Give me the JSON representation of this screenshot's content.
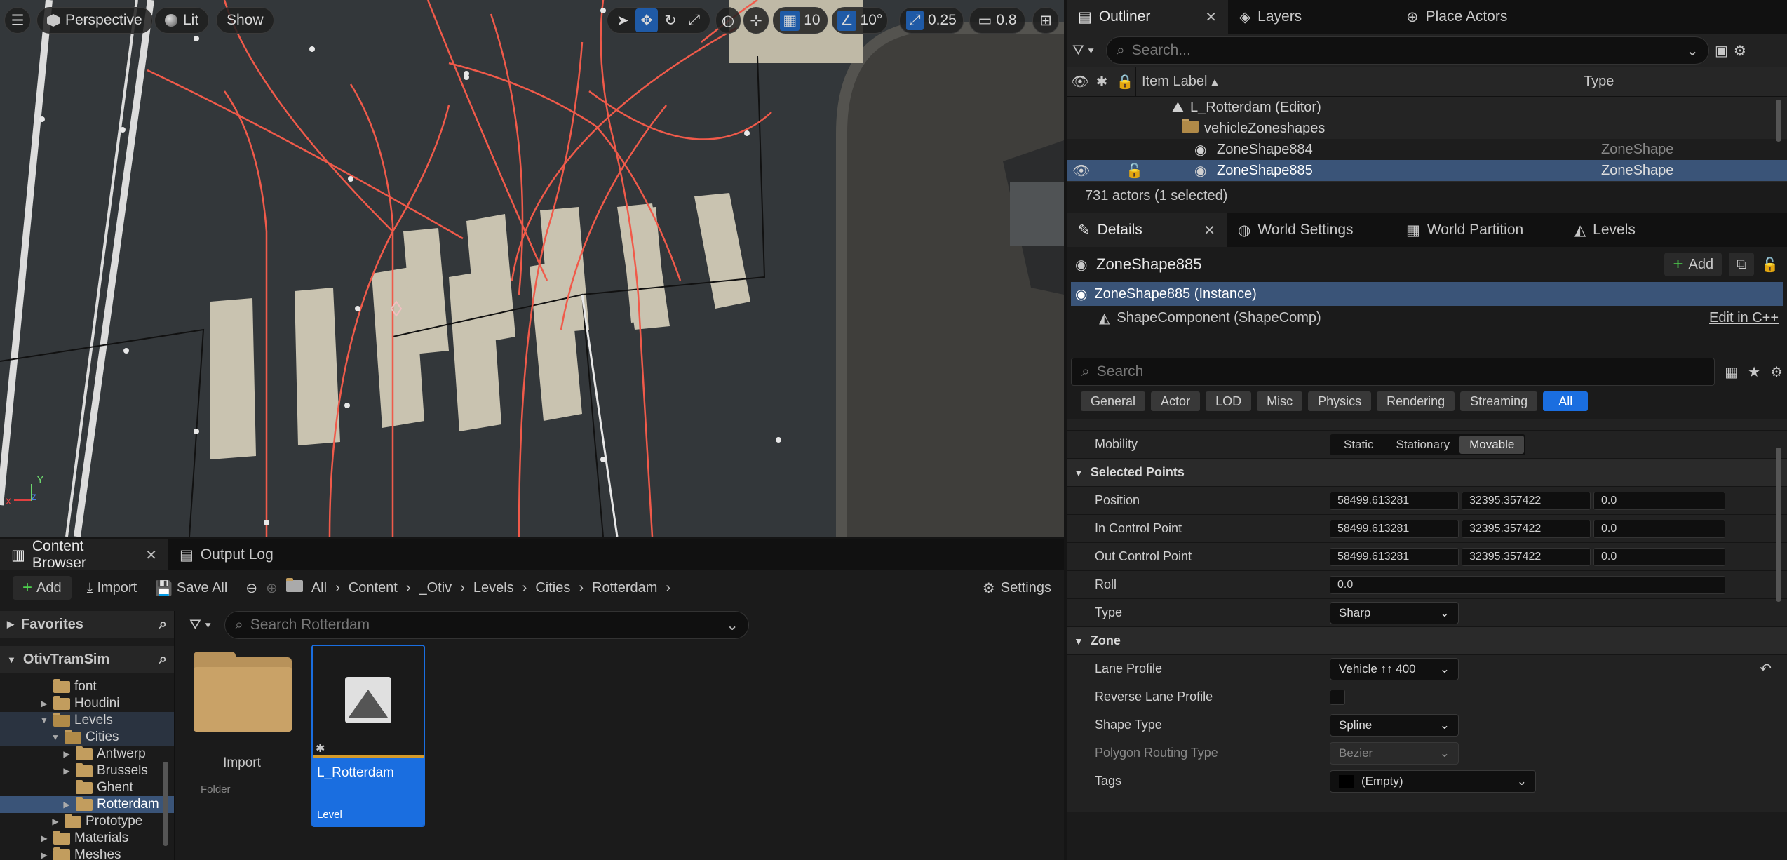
{
  "viewport": {
    "perspective_label": "Perspective",
    "lit_label": "Lit",
    "show_label": "Show",
    "grid_snap_value": "10",
    "rotation_snap_value": "10°",
    "scale_snap_value": "0.25",
    "camera_speed_value": "0.8",
    "axis_x": "x",
    "axis_y": "Y",
    "axis_z": "z"
  },
  "outliner": {
    "tabs": [
      {
        "label": "Outliner",
        "icon": "outliner-icon",
        "active": true
      },
      {
        "label": "Layers",
        "icon": "layers-icon"
      },
      {
        "label": "Place Actors",
        "icon": "place-actors-icon"
      }
    ],
    "search_placeholder": "Search...",
    "columns": {
      "item_label": "Item Label",
      "type": "Type"
    },
    "rows": [
      {
        "label": "L_Rotterdam (Editor)",
        "type": "",
        "kind": "level"
      },
      {
        "label": "vehicleZoneshapes",
        "type": "",
        "kind": "folder"
      },
      {
        "label": "ZoneShape884",
        "type": "ZoneShape",
        "kind": "actor"
      },
      {
        "label": "ZoneShape885",
        "type": "ZoneShape",
        "kind": "actor",
        "selected": true
      }
    ],
    "status": "731 actors (1 selected)"
  },
  "details": {
    "tabs": [
      {
        "label": "Details",
        "icon": "details-icon",
        "active": true
      },
      {
        "label": "World Settings",
        "icon": "world-settings-icon"
      },
      {
        "label": "World Partition",
        "icon": "world-partition-icon"
      },
      {
        "label": "Levels",
        "icon": "levels-icon"
      }
    ],
    "actor_name": "ZoneShape885",
    "add_label": "Add",
    "components": [
      {
        "label": "ZoneShape885 (Instance)",
        "selected": true
      },
      {
        "label": "ShapeComponent (ShapeComp)",
        "link": "Edit in C++"
      }
    ],
    "search_placeholder": "Search",
    "filters": [
      "General",
      "Actor",
      "LOD",
      "Misc",
      "Physics",
      "Rendering",
      "Streaming",
      "All"
    ],
    "active_filter": "All",
    "mobility": {
      "label": "Mobility",
      "options": [
        "Static",
        "Stationary",
        "Movable"
      ],
      "selected": "Movable"
    },
    "selected_points": {
      "header": "Selected Points",
      "position": {
        "label": "Position",
        "x": "58499.613281",
        "y": "32395.357422",
        "z": "0.0"
      },
      "in_control": {
        "label": "In Control Point",
        "x": "58499.613281",
        "y": "32395.357422",
        "z": "0.0"
      },
      "out_control": {
        "label": "Out Control Point",
        "x": "58499.613281",
        "y": "32395.357422",
        "z": "0.0"
      },
      "roll": {
        "label": "Roll",
        "value": "0.0"
      },
      "type": {
        "label": "Type",
        "value": "Sharp"
      }
    },
    "zone": {
      "header": "Zone",
      "lane_profile": {
        "label": "Lane Profile",
        "value": "Vehicle ↑↑ 400"
      },
      "reverse_lane_profile": {
        "label": "Reverse Lane Profile"
      },
      "shape_type": {
        "label": "Shape Type",
        "value": "Spline"
      },
      "polygon_routing_type": {
        "label": "Polygon Routing Type",
        "value": "Bezier"
      },
      "tags": {
        "label": "Tags",
        "value": "(Empty)"
      }
    }
  },
  "content_browser": {
    "tabs": [
      {
        "label": "Content Browser",
        "icon": "content-browser-icon",
        "active": true
      },
      {
        "label": "Output Log",
        "icon": "output-log-icon"
      }
    ],
    "add_label": "Add",
    "import_label": "Import",
    "save_all_label": "Save All",
    "breadcrumbs": [
      "All",
      "Content",
      "_Otiv",
      "Levels",
      "Cities",
      "Rotterdam"
    ],
    "settings_label": "Settings",
    "favorites_label": "Favorites",
    "project_label": "OtivTramSim",
    "search_placeholder": "Search Rotterdam",
    "tree": [
      {
        "label": "font",
        "depth": 2,
        "caret": false
      },
      {
        "label": "Houdini",
        "depth": 2,
        "caret": true
      },
      {
        "label": "Levels",
        "depth": 2,
        "caret": true,
        "open": true
      },
      {
        "label": "Cities",
        "depth": 3,
        "caret": true,
        "open": true
      },
      {
        "label": "Antwerp",
        "depth": 4,
        "caret": true
      },
      {
        "label": "Brussels",
        "depth": 4,
        "caret": true
      },
      {
        "label": "Ghent",
        "depth": 4,
        "caret": false
      },
      {
        "label": "Rotterdam",
        "depth": 4,
        "caret": true,
        "selected": true
      },
      {
        "label": "Prototype",
        "depth": 3,
        "caret": true
      },
      {
        "label": "Materials",
        "depth": 2,
        "caret": true
      },
      {
        "label": "Meshes",
        "depth": 2,
        "caret": true
      }
    ],
    "assets": [
      {
        "name": "Import",
        "type": "Folder"
      },
      {
        "name": "L_Rotterdam",
        "type": "Level",
        "selected": true
      }
    ]
  }
}
